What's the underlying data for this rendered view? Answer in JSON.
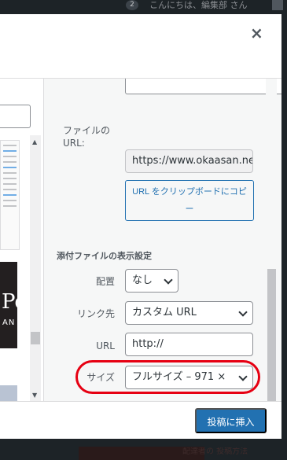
{
  "admin_bar": {
    "notification_count": "2",
    "greeting": "こんにちは、編集部 さん"
  },
  "modal": {
    "close_glyph": "×"
  },
  "details": {
    "file_url_label": "ファイルの URL:",
    "file_url_value": "https://www.okaasan.net/",
    "copy_button": "URL をクリップボードにコピー"
  },
  "display_settings": {
    "heading": "添付ファイルの表示設定",
    "alignment_label": "配置",
    "alignment_value": "なし",
    "link_label": "リンク先",
    "link_value": "カスタム URL",
    "url_label": "URL",
    "url_value": "http://",
    "size_label": "サイズ",
    "size_value": "フルサイズ – 971 ×"
  },
  "media_grid": {
    "thumb2_text_top": "Pe",
    "thumb2_text_bottom": "AN"
  },
  "footer": {
    "insert_button": "投稿に挿入"
  },
  "background": {
    "peek_text": "配達者の\n投稿方法"
  },
  "highlight_color": "#e60012",
  "accent_color": "#2271b1"
}
